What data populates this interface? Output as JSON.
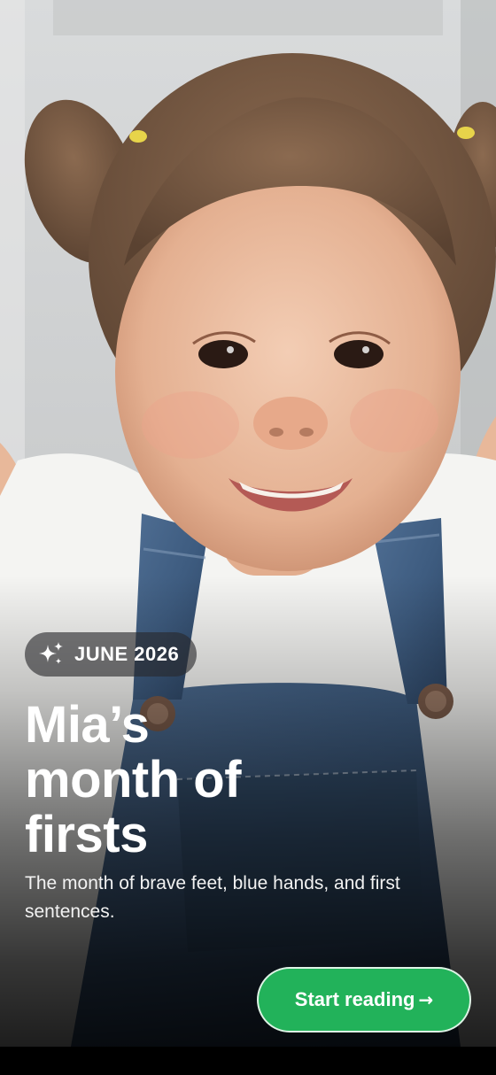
{
  "story": {
    "date_label": "JUNE 2026",
    "title_lines": [
      "Mia’s",
      "month of",
      "firsts"
    ],
    "subtitle": "The month of brave feet, blue hands, and first sentences.",
    "cta_label": "Start reading",
    "cta_arrow": "→"
  },
  "icons": {
    "date": "sparkle-icon",
    "cta": "arrow-right-icon"
  },
  "colors": {
    "accent_green": "#22b25a",
    "pill_bg": "#28282c",
    "text": "#ffffff"
  }
}
